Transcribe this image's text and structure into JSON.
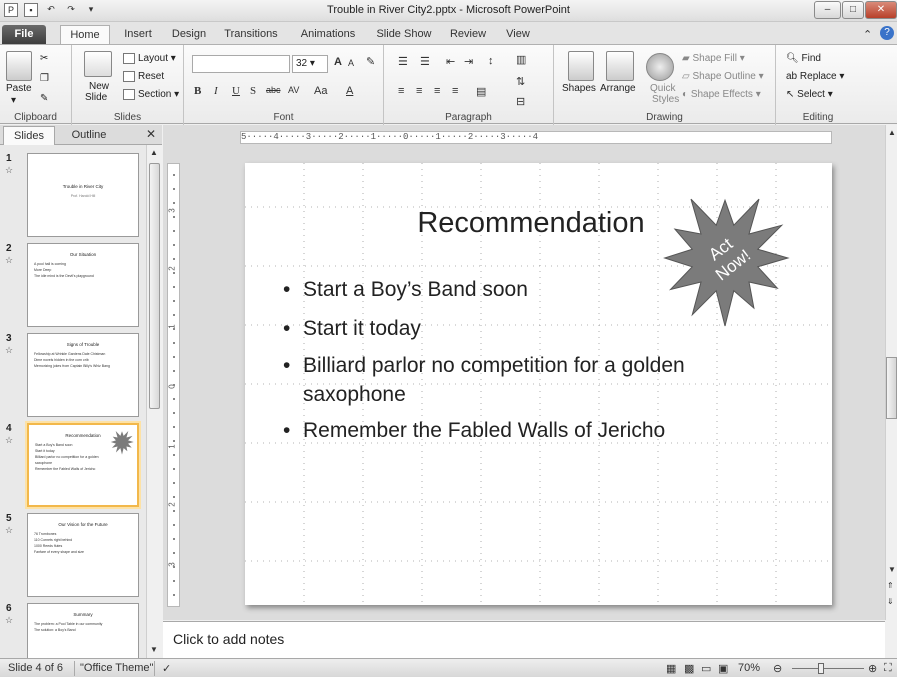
{
  "window": {
    "title": "Trouble in River City2.pptx - Microsoft PowerPoint",
    "minimize": "–",
    "maximize": "□",
    "close": "✕"
  },
  "ribbon_tabs": [
    "File",
    "Home",
    "Insert",
    "Design",
    "Transitions",
    "Animations",
    "Slide Show",
    "Review",
    "View"
  ],
  "ribbon": {
    "clipboard": {
      "label": "Clipboard",
      "paste": "Paste"
    },
    "slides": {
      "label": "Slides",
      "new_slide_1": "New",
      "new_slide_2": "Slide",
      "layout": "Layout",
      "reset": "Reset",
      "section": "Section"
    },
    "font": {
      "label": "Font",
      "size": "32",
      "grow": "A",
      "shrink": "A",
      "bold": "B",
      "italic": "I",
      "underline": "U",
      "shadow": "S",
      "strike": "abc",
      "spacing": "AV",
      "case": "Aa",
      "color": "A"
    },
    "paragraph": {
      "label": "Paragraph"
    },
    "drawing": {
      "label": "Drawing",
      "shapes": "Shapes",
      "arrange": "Arrange",
      "quick_1": "Quick",
      "quick_2": "Styles",
      "fill": "Shape Fill",
      "outline": "Shape Outline",
      "effects": "Shape Effects"
    },
    "editing": {
      "label": "Editing",
      "find": "Find",
      "replace": "Replace",
      "select": "Select"
    }
  },
  "pane": {
    "tab_slides": "Slides",
    "tab_outline": "Outline",
    "close": "✕",
    "thumbnails": [
      {
        "num": "1",
        "title": "Trouble in River City",
        "lines": [
          "Prof. Harold Hill"
        ],
        "kind": "title"
      },
      {
        "num": "2",
        "title": "Our Situation",
        "lines": [
          "A pool hall is coming",
          "More Deep",
          "The idle mind is the Devil's playground"
        ],
        "kind": "list"
      },
      {
        "num": "3",
        "title": "Signs of Trouble",
        "lines": [
          "Fellowship at Wrinkle Gardens  Dale Chistman",
          "Dime novels hidden in the corn crib",
          "Memorizing jokes from Captain Billy's Whiz Bang"
        ],
        "kind": "list"
      },
      {
        "num": "4",
        "title": "Recommendation",
        "lines": [
          "Start a Boy's Band soon",
          "Start it today",
          "Billiard parlor no competition for a golden",
          "saxophone",
          "Remember the Fabled Walls of Jericho"
        ],
        "kind": "list"
      },
      {
        "num": "5",
        "title": "Our Vision for the Future",
        "lines": [
          "76 Trombones",
          "110 Cornets right behind",
          "1000 Reeds  flutes",
          "Fanfare of every shape and size"
        ],
        "kind": "list"
      },
      {
        "num": "6",
        "title": "Summary",
        "lines": [
          "The problem: a Pool Table in our community",
          "The solution: a Boy's Band"
        ],
        "kind": "list"
      }
    ]
  },
  "ruler": {
    "h": "5·····4·····3·····2·····1·····0·····1·····2·····3·····4",
    "v": [
      "3",
      "2",
      "1",
      "0",
      "1",
      "2",
      "3"
    ]
  },
  "slide": {
    "title": "Recommendation",
    "bullets": [
      "Start a Boy’s Band soon",
      "Start it today",
      "Billiard parlor no competition for a golden saxophone",
      "Remember the Fabled Walls of Jericho"
    ],
    "starburst_line1": "Act",
    "starburst_line2": "Now!",
    "starburst_color": "#7b7b7b"
  },
  "notes": {
    "placeholder": "Click to add notes"
  },
  "status": {
    "slide": "Slide 4 of 6",
    "theme": "\"Office Theme\"",
    "zoom": "70%"
  }
}
